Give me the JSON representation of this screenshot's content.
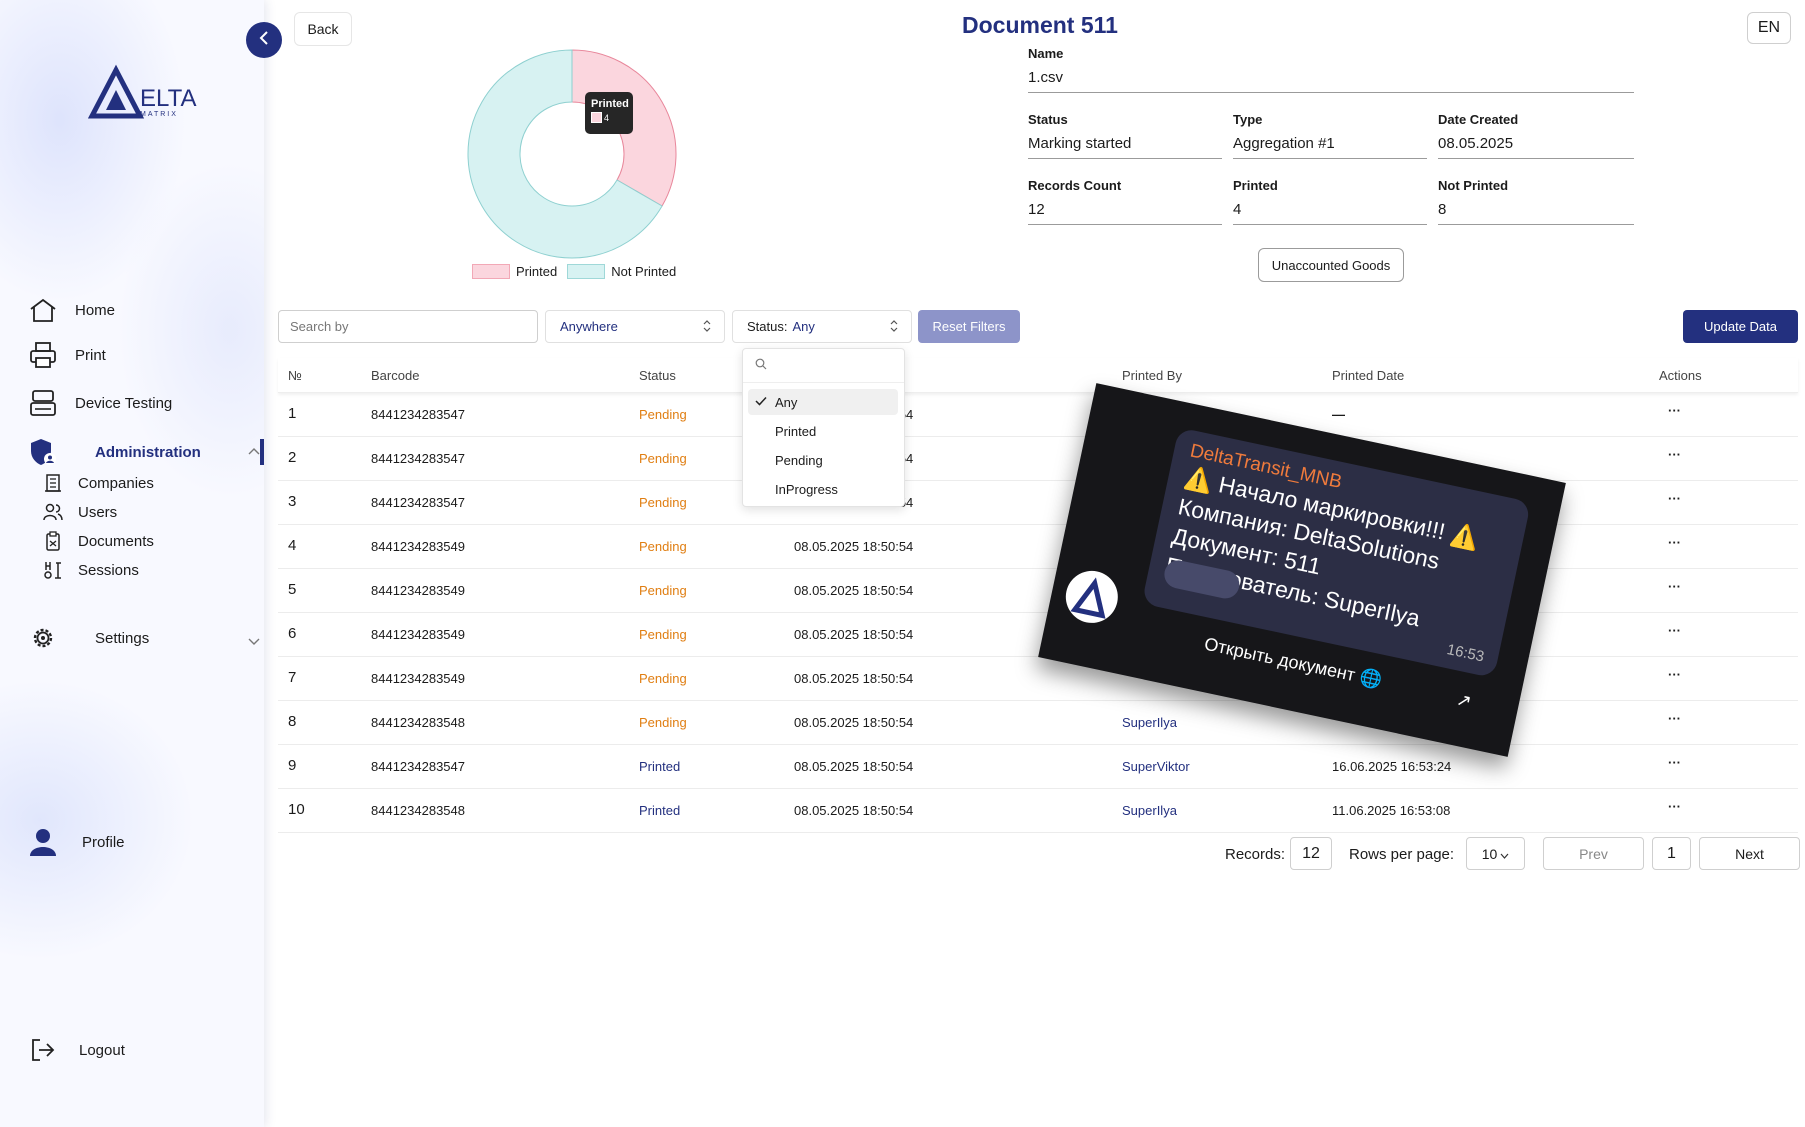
{
  "sidebar": {
    "logo_text": "ΔELTA",
    "logo_sub": "MATRIX",
    "items": [
      {
        "label": "Home",
        "icon": "home-icon"
      },
      {
        "label": "Print",
        "icon": "printer-icon"
      },
      {
        "label": "Device Testing",
        "icon": "device-icon"
      },
      {
        "label": "Administration",
        "icon": "shield-user-icon"
      },
      {
        "label": "Settings",
        "icon": "gear-icon"
      },
      {
        "label": "Profile",
        "icon": "user-icon"
      },
      {
        "label": "Logout",
        "icon": "logout-icon"
      }
    ],
    "admin_sub": [
      {
        "label": "Companies",
        "icon": "building-icon"
      },
      {
        "label": "Users",
        "icon": "users-icon"
      },
      {
        "label": "Documents",
        "icon": "clipboard-icon"
      },
      {
        "label": "Sessions",
        "icon": "sessions-icon"
      }
    ]
  },
  "header": {
    "back_label": "Back",
    "title": "Document 511",
    "lang": "EN"
  },
  "chart_data": {
    "type": "pie",
    "categories": [
      "Printed",
      "Not Printed"
    ],
    "values": [
      4,
      8
    ],
    "colors": [
      "#fbd6de",
      "#d7f2f2"
    ],
    "tooltip": {
      "label": "Printed",
      "value": "4"
    },
    "legend_placement": "bottom"
  },
  "info": {
    "name_label": "Name",
    "name_value": "1.csv",
    "status_label": "Status",
    "status_value": "Marking started",
    "type_label": "Type",
    "type_value": "Aggregation #1",
    "date_label": "Date Created",
    "date_value": "08.05.2025",
    "records_label": "Records Count",
    "records_value": "12",
    "printed_label": "Printed",
    "printed_value": "4",
    "notprinted_label": "Not Printed",
    "notprinted_value": "8",
    "unaccounted_label": "Unaccounted Goods"
  },
  "filters": {
    "search_placeholder": "Search by",
    "scope_value": "Anywhere",
    "status_prefix": "Status:",
    "status_value": "Any",
    "reset_label": "Reset Filters",
    "update_label": "Update Data",
    "dropdown_options": [
      "Any",
      "Printed",
      "Pending",
      "InProgress"
    ]
  },
  "table": {
    "headers": [
      "№",
      "Barcode",
      "Status",
      "Printed By",
      "Printed Date",
      "Actions"
    ],
    "rows": [
      {
        "no": "1",
        "barcode": "8441234283547",
        "status": "Pending",
        "created": "08.05.2025 18:50:54",
        "by": "",
        "date": "—"
      },
      {
        "no": "2",
        "barcode": "8441234283547",
        "status": "Pending",
        "created": "08.05.2025 18:50:54",
        "by": "",
        "date": ""
      },
      {
        "no": "3",
        "barcode": "8441234283547",
        "status": "Pending",
        "created": "08.05.2025 18:50:54",
        "by": "",
        "date": ""
      },
      {
        "no": "4",
        "barcode": "8441234283549",
        "status": "Pending",
        "created": "08.05.2025 18:50:54",
        "by": "",
        "date": ""
      },
      {
        "no": "5",
        "barcode": "8441234283549",
        "status": "Pending",
        "created": "08.05.2025 18:50:54",
        "by": "",
        "date": ""
      },
      {
        "no": "6",
        "barcode": "8441234283549",
        "status": "Pending",
        "created": "08.05.2025 18:50:54",
        "by": "",
        "date": ""
      },
      {
        "no": "7",
        "barcode": "8441234283549",
        "status": "Pending",
        "created": "08.05.2025 18:50:54",
        "by": "",
        "date": ""
      },
      {
        "no": "8",
        "barcode": "8441234283548",
        "status": "Pending",
        "created": "08.05.2025 18:50:54",
        "by": "SuperIlya",
        "date": ""
      },
      {
        "no": "9",
        "barcode": "8441234283547",
        "status": "Printed",
        "created": "08.05.2025 18:50:54",
        "by": "SuperViktor",
        "date": "16.06.2025 16:53:24"
      },
      {
        "no": "10",
        "barcode": "8441234283548",
        "status": "Printed",
        "created": "08.05.2025 18:50:54",
        "by": "SuperIlya",
        "date": "11.06.2025 16:53:08"
      }
    ],
    "actions_glyph": "···"
  },
  "overlay": {
    "sender": "DeltaTransit_MNB",
    "line1": "⚠️ Начало маркировки!!! ⚠️",
    "line2": "Компания: DeltaSolutions",
    "line3": "Документ: 511",
    "line4": "Пользователь: SuperIlya",
    "time": "16:53",
    "open_label": "Открыть документ 🌐"
  },
  "pagination": {
    "records_label": "Records:",
    "records_value": "12",
    "rows_label": "Rows per page:",
    "rows_value": "10",
    "prev_label": "Prev",
    "page_value": "1",
    "next_label": "Next"
  }
}
